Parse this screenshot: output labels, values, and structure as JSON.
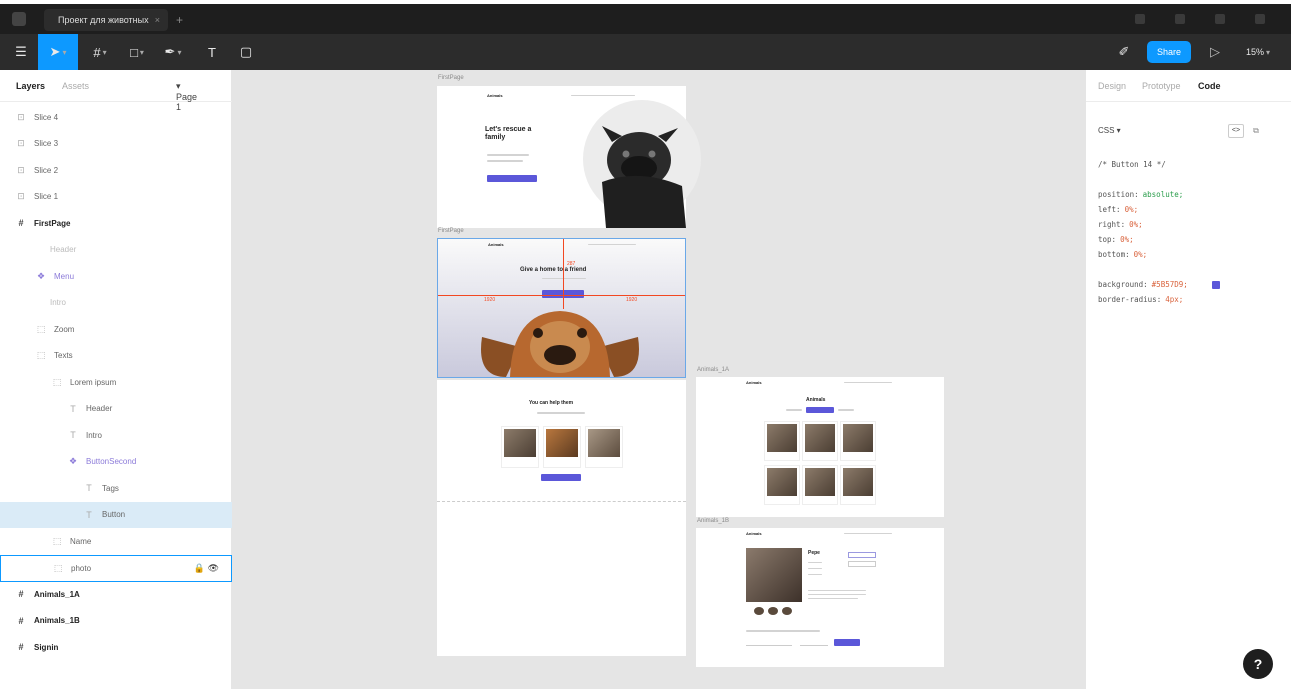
{
  "window": {
    "tab_title": "Проект для животных",
    "tab_close": "×",
    "new_tab": "+"
  },
  "toolbar": {
    "share_label": "Share",
    "zoom_label": "15%",
    "play_icon": "play-icon",
    "tools": [
      "main-menu-icon",
      "move-tool-icon",
      "frame-tool-icon",
      "shape-tool-icon",
      "pen-tool-icon",
      "text-tool-icon",
      "comment-tool-icon"
    ]
  },
  "left_panel": {
    "tab_layers": "Layers",
    "tab_assets": "Assets",
    "page_selector": "Page 1",
    "layers": [
      {
        "label": "Slice 4",
        "kind": "slice"
      },
      {
        "label": "Slice 3",
        "kind": "slice"
      },
      {
        "label": "Slice 2",
        "kind": "slice"
      },
      {
        "label": "Slice 1",
        "kind": "slice"
      },
      {
        "label": "FirstPage",
        "kind": "frame"
      },
      {
        "label": "Header",
        "kind": "muted"
      },
      {
        "label": "Menu",
        "kind": "comp"
      },
      {
        "label": "Intro",
        "kind": "muted"
      },
      {
        "label": "Zoom",
        "kind": "group"
      },
      {
        "label": "Texts",
        "kind": "group"
      },
      {
        "label": "Lorem ipsum",
        "kind": "group"
      },
      {
        "label": "Header",
        "kind": "text"
      },
      {
        "label": "Intro",
        "kind": "text"
      },
      {
        "label": "ButtonSecond",
        "kind": "comp"
      },
      {
        "label": "Tags",
        "kind": "text"
      },
      {
        "label": "Button",
        "kind": "selected"
      },
      {
        "label": "Name",
        "kind": "group"
      },
      {
        "label": "photo",
        "kind": "hover"
      },
      {
        "label": "Animals_1A",
        "kind": "frame"
      },
      {
        "label": "Animals_1B",
        "kind": "frame"
      },
      {
        "label": "Signin",
        "kind": "frame"
      }
    ]
  },
  "right_panel": {
    "tab_design": "Design",
    "tab_prototype": "Prototype",
    "tab_code": "Code",
    "lang_selector": "CSS",
    "code_comment": "/* Button 14 */",
    "code_lines": [
      {
        "prop": "position:",
        "val": "absolute;",
        "cls": "s"
      },
      {
        "prop": "left:",
        "val": "0%;",
        "cls": "v"
      },
      {
        "prop": "right:",
        "val": "0%;",
        "cls": "v"
      },
      {
        "prop": "top:",
        "val": "0%;",
        "cls": "v"
      },
      {
        "prop": "bottom:",
        "val": "0%;",
        "cls": "v"
      }
    ],
    "code_lines2": [
      {
        "prop": "background:",
        "val": "#5B57D9;",
        "cls": "v"
      },
      {
        "prop": "border-radius:",
        "val": "4px;",
        "cls": "v"
      }
    ],
    "swatch_color": "#5b57d9",
    "help_label": "?"
  },
  "canvas": {
    "frames": {
      "first_label": "FirstPage",
      "second_label": "FirstPage",
      "animals_a_label": "Animals_1A",
      "animals_b_label": "Animals_1B",
      "hero_title": "Let's rescue a family",
      "hero2_title": "Give a home to a friend",
      "section_title": "You can help them",
      "animals_title": "Animals",
      "pet_name": "Pepe",
      "brand": "Animals",
      "measure_top": "287",
      "measure_left": "1920",
      "measure_right": "1920"
    },
    "accent": "#5b57d9",
    "measure_color": "#f24822"
  }
}
